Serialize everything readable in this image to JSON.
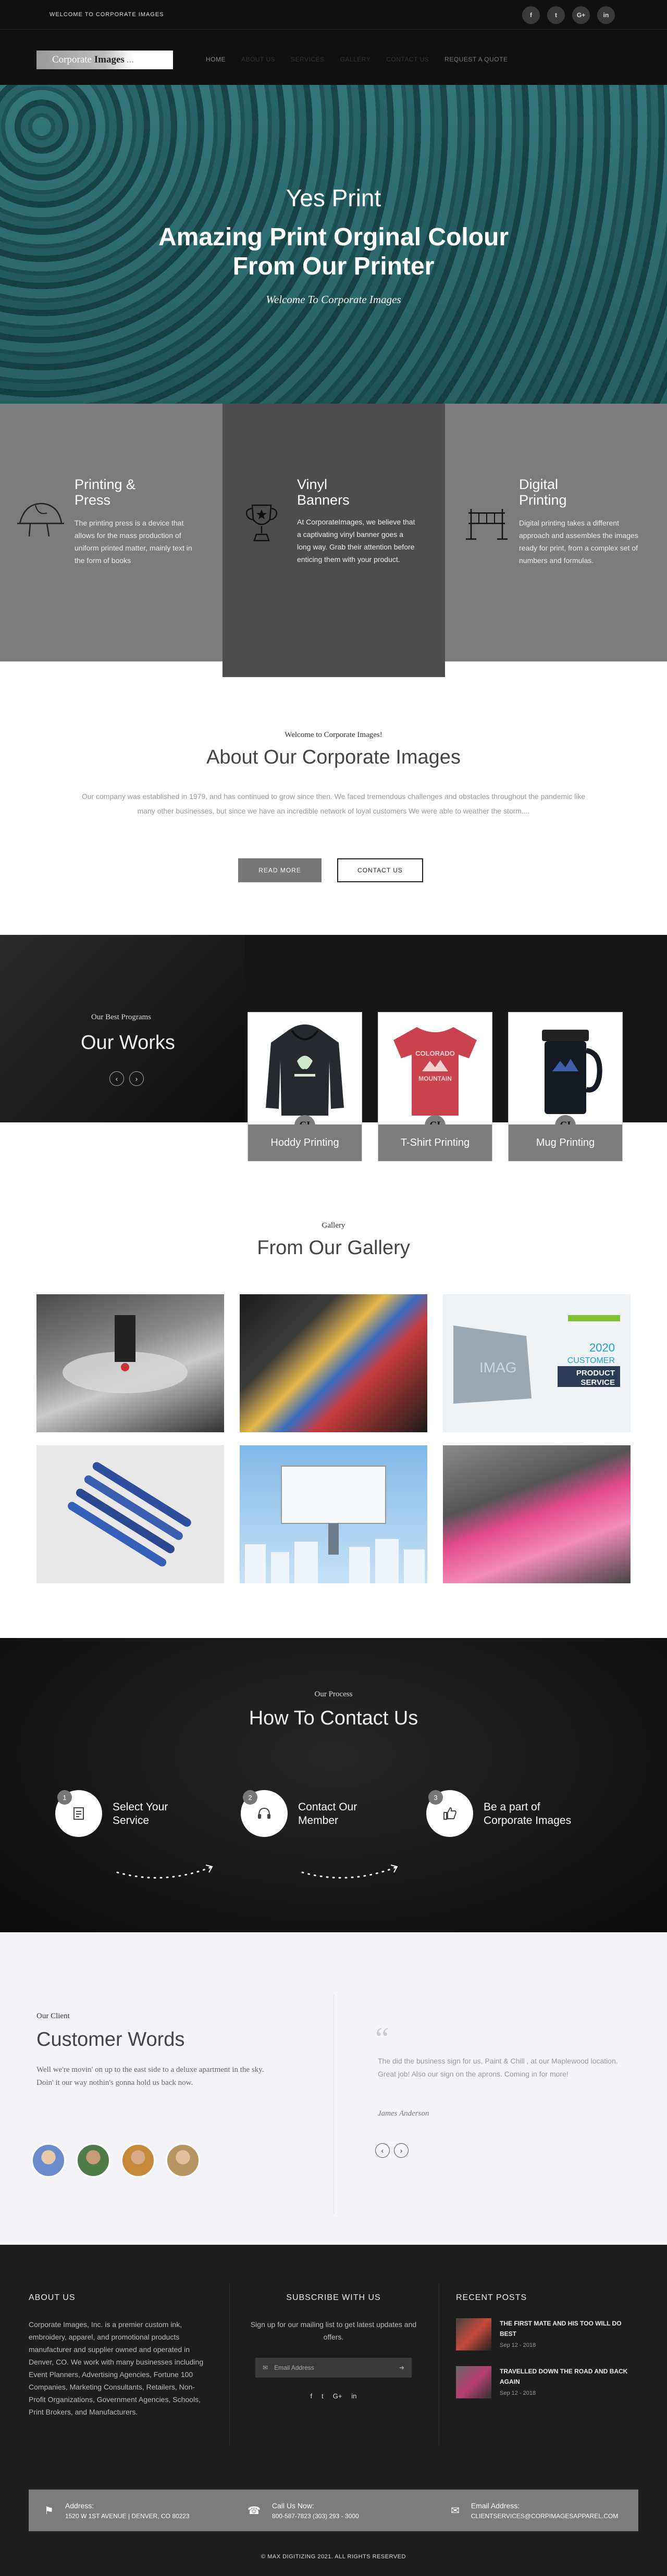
{
  "topbar": {
    "welcome": "WELCOME TO CORPORATE IMAGES",
    "socials": [
      "f",
      "t",
      "G+",
      "in"
    ]
  },
  "nav": {
    "logo_text_a": "Corporate",
    "logo_text_b": "Images",
    "logo_dots": "...",
    "items": [
      "HOME",
      "ABOUT US",
      "SERVICES",
      "GALLERY",
      "CONTACT US",
      "REQUEST A QUOTE"
    ]
  },
  "hero": {
    "pre": "Yes Print",
    "title": "Amazing Print Orginal Colour From Our Printer",
    "sub": "Welcome To Corporate Images"
  },
  "services": [
    {
      "title": "Printing & Press",
      "text": "The printing press is a device that allows for the mass production of uniform printed matter, mainly text in the form of books"
    },
    {
      "title": "Vinyl Banners",
      "text": "At CorporateImages, we believe that a captivating vinyl banner goes a long way. Grab their attention before enticing them with your product."
    },
    {
      "title": "Digital Printing",
      "text": "Digital printing takes a different approach and assembles the images ready for print, from a complex set of numbers and formulas."
    }
  ],
  "about": {
    "kicker": "Welcome to Corporate Images!",
    "title": "About Our Corporate Images",
    "text": "Our company was established in 1979, and has continued to grow since then. We faced tremendous challenges and obstacles throughout the pandemic like many other businesses, but since we have an incredible network of loyal customers We were able to weather the storm....",
    "read_more": "READ MORE",
    "contact": "CONTACT US"
  },
  "works": {
    "kicker": "Our Best Programs",
    "title": "Our Works",
    "prev": "‹",
    "next": "›",
    "cards": [
      {
        "label": "Hoddy Printing",
        "badge": "CI"
      },
      {
        "label": "T-Shirt Printing",
        "badge": "CI"
      },
      {
        "label": "Mug Printing",
        "badge": "CI"
      }
    ]
  },
  "gallery": {
    "kicker": "Gallery",
    "title": "From Our Gallery",
    "flyer_year": "2020",
    "flyer_line1": "CUSTOMER",
    "flyer_line2": "PRODUCT",
    "flyer_line3": "SERVICE",
    "flyer_brand": "IMAG"
  },
  "process": {
    "kicker": "Our Process",
    "title": "How To Contact Us",
    "steps": [
      {
        "num": "1",
        "text": "Select Your Service"
      },
      {
        "num": "2",
        "text": "Contact Our Member"
      },
      {
        "num": "3",
        "text": "Be a part of Corporate Images"
      }
    ]
  },
  "testimonials": {
    "kicker": "Our Client",
    "title": "Customer Words",
    "body": "Well we're movin' on up to the east side to a deluxe apartment in the sky. Doin' it our way nothin's gonna hold us back now.",
    "quote": "The did the business sign for us, Paint & Chill , at our Maplewood location. Great job! Also our sign on the aprons. Coming in for more!",
    "author": "James Anderson",
    "quote_mark": "“"
  },
  "footer": {
    "about_title": "ABOUT US",
    "about_text": "Corporate Images, Inc. is a premier custom ink, embroidery, apparel, and promotional products manufacturer and supplier owned and operated in Denver, CO. We work with many businesses including Event Planners, Advertising Agencies, Fortune 100 Companies, Marketing Consultants, Retailers, Non-Profit Organizations, Government Agencies, Schools, Print Brokers, and Manufacturers.",
    "subscribe_title": "SUBSCRIBE WITH US",
    "subscribe_text": "Sign up for our mailing list to get latest updates and offers.",
    "email_placeholder": "Email Address",
    "socials": [
      "f",
      "t",
      "G+",
      "in"
    ],
    "posts_title": "RECENT POSTS",
    "posts": [
      {
        "title": "THE FIRST MATE AND HIS TOO WILL DO BEST",
        "date": "Sep 12 - 2018"
      },
      {
        "title": "TRAVELLED DOWN THE ROAD AND BACK AGAIN",
        "date": "Sep 12 - 2018"
      }
    ],
    "contact": [
      {
        "label": "Address:",
        "value": "1520 W 1ST AVENUE | DENVER, CO 80223",
        "icon": "⚑"
      },
      {
        "label": "Call Us Now:",
        "value": "800-587-7823 (303) 293 - 3000",
        "icon": "☎"
      },
      {
        "label": "Email Address:",
        "value": "CLIENTSERVICES@CORPIMAGESAPPAREL.COM",
        "icon": "✉"
      }
    ],
    "copyright": "© MAX DIGITIZING 2021. ALL RIGHTS RESERVED"
  }
}
